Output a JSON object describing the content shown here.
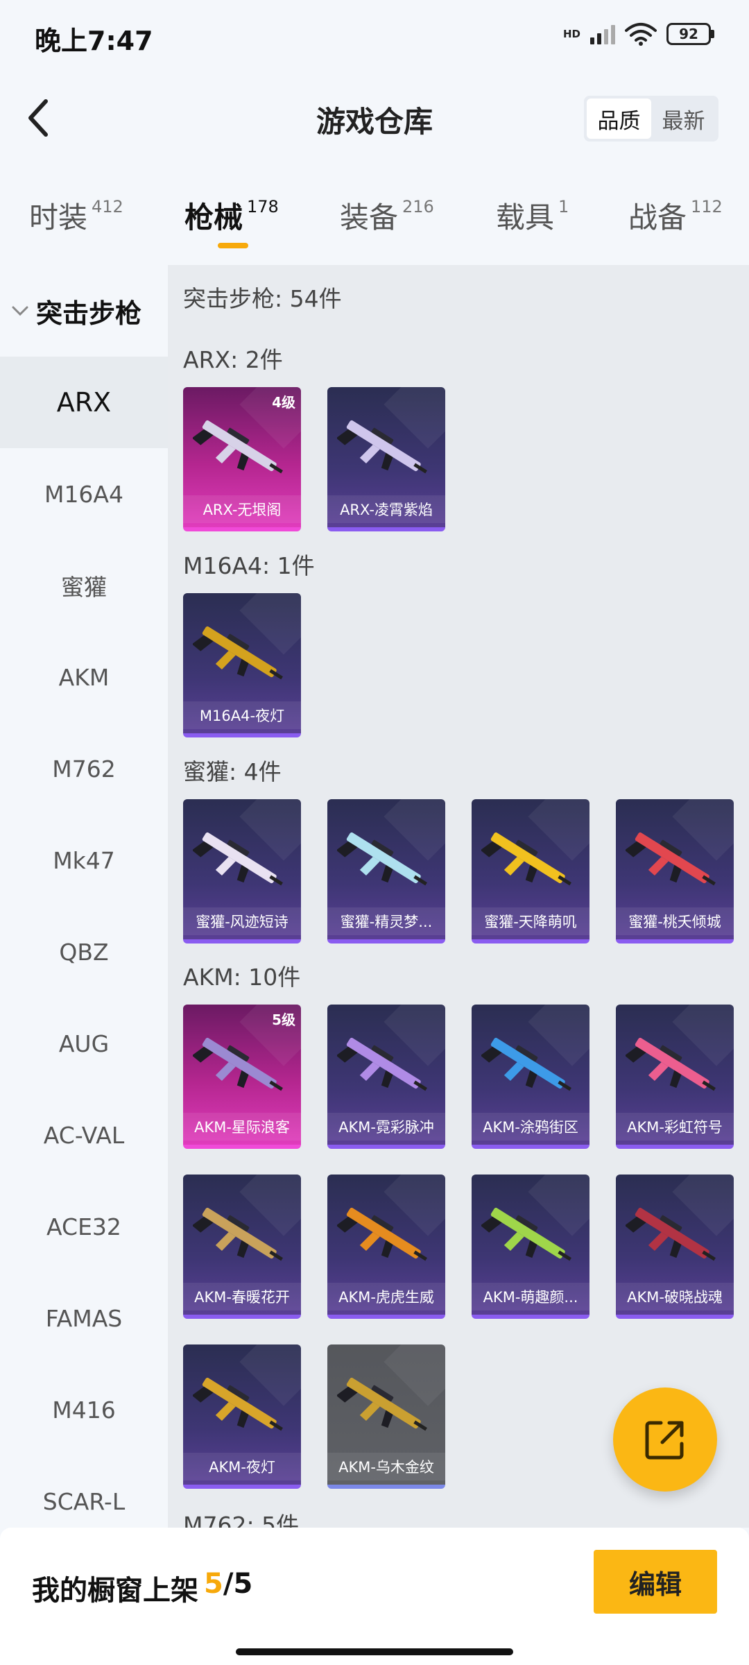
{
  "status_bar": {
    "time": "晚上7:47",
    "hd": "HD",
    "battery": "92"
  },
  "header": {
    "title": "游戏仓库",
    "sort_options": [
      "品质",
      "最新"
    ],
    "sort_active": "品质"
  },
  "category_tabs": [
    {
      "label": "时装",
      "count": "412"
    },
    {
      "label": "枪械",
      "count": "178"
    },
    {
      "label": "装备",
      "count": "216"
    },
    {
      "label": "载具",
      "count": "1"
    },
    {
      "label": "战备",
      "count": "112"
    }
  ],
  "active_category": "枪械",
  "sidebar": {
    "group": "突击步枪",
    "items": [
      "ARX",
      "M16A4",
      "蜜獾",
      "AKM",
      "M762",
      "Mk47",
      "QBZ",
      "AUG",
      "AC-VAL",
      "ACE32",
      "FAMAS",
      "M416",
      "SCAR-L"
    ],
    "active": "ARX"
  },
  "main": {
    "summary": "突击步枪: 54件",
    "sections": [
      {
        "title": "ARX: 2件",
        "items": [
          {
            "name": "ARX-无垠阁",
            "level": "4级",
            "style": "pink",
            "color": "#d7d2e8"
          },
          {
            "name": "ARX-凌霄紫焰",
            "style": "purple",
            "color": "#cfc6ec"
          }
        ]
      },
      {
        "title": "M16A4: 1件",
        "items": [
          {
            "name": "M16A4-夜灯",
            "style": "purple",
            "color": "#d4a21e"
          }
        ]
      },
      {
        "title": "蜜獾: 4件",
        "items": [
          {
            "name": "蜜獾-风迹短诗",
            "style": "purple",
            "color": "#e9e2f2"
          },
          {
            "name": "蜜獾-精灵梦...",
            "style": "purple",
            "color": "#aee0ef"
          },
          {
            "name": "蜜獾-天降萌叽",
            "style": "purple",
            "color": "#f1c11f"
          },
          {
            "name": "蜜獾-桃夭倾城",
            "style": "purple",
            "color": "#e2474f"
          }
        ]
      },
      {
        "title": "AKM: 10件",
        "items": [
          {
            "name": "AKM-星际浪客",
            "level": "5级",
            "style": "pink",
            "color": "#9b8ad2"
          },
          {
            "name": "AKM-霓彩脉冲",
            "style": "purple",
            "color": "#b08be6"
          },
          {
            "name": "AKM-涂鸦街区",
            "style": "purple",
            "color": "#3d9be8"
          },
          {
            "name": "AKM-彩虹符号",
            "style": "purple",
            "color": "#ec5e8f"
          },
          {
            "name": "AKM-春暖花开",
            "style": "purple",
            "color": "#c9a25b"
          },
          {
            "name": "AKM-虎虎生威",
            "style": "purple",
            "color": "#e68c1f"
          },
          {
            "name": "AKM-萌趣颜...",
            "style": "purple",
            "color": "#9fd64a"
          },
          {
            "name": "AKM-破晓战魂",
            "style": "purple",
            "color": "#b23344"
          },
          {
            "name": "AKM-夜灯",
            "style": "purple",
            "color": "#d8a52a"
          },
          {
            "name": "AKM-乌木金纹",
            "style": "gray",
            "color": "#caa031"
          }
        ]
      },
      {
        "title": "M762: 5件",
        "items": []
      }
    ]
  },
  "bottom_bar": {
    "label": "我的橱窗上架",
    "current": "5",
    "total": "/5",
    "edit": "编辑"
  }
}
